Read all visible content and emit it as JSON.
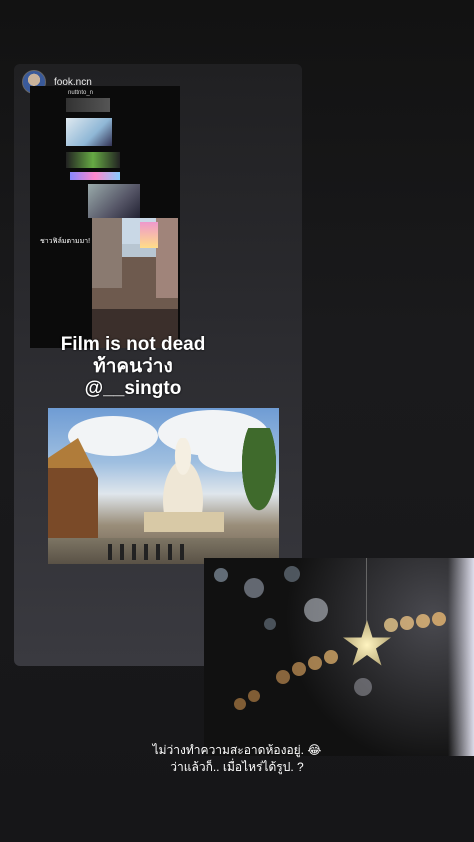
{
  "story": {
    "repost": {
      "username": "fook.ncn",
      "mini_story": {
        "username": "nuttnto_n",
        "caption": "ชาวฟิล์มตามมา!"
      }
    },
    "title_lines": [
      "Film is not dead",
      "ท้าคนว่าง",
      "@__singto"
    ],
    "caption_lines": [
      "ไม่ว่างทำความสะอาดห้องอยู่. 😂",
      "ว่าแล้วก็.. เมื่อไหร่ได้รูป. ?"
    ]
  }
}
